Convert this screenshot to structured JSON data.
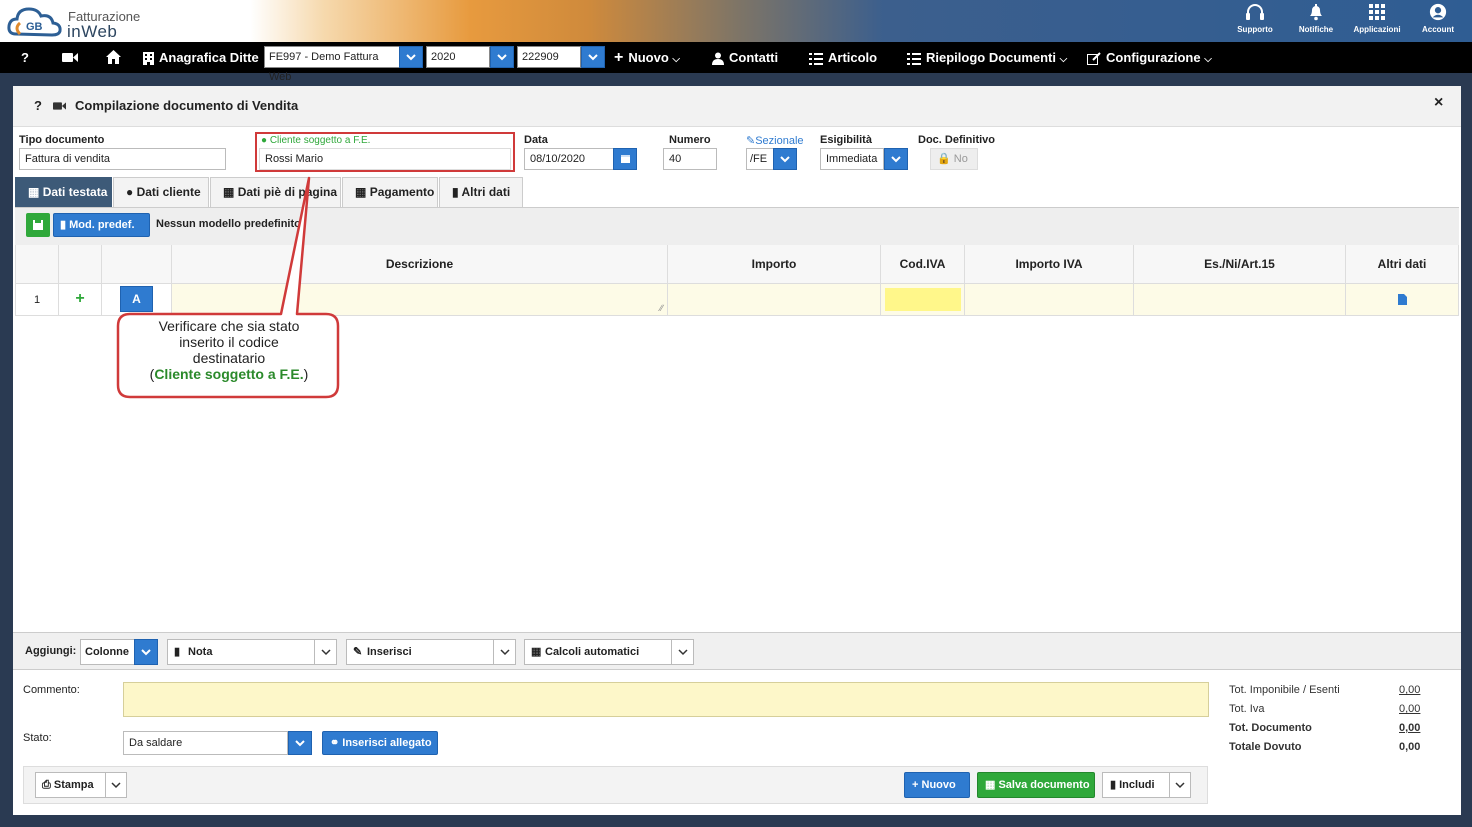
{
  "brand": {
    "line1": "Fatturazione",
    "line2": "inWeb"
  },
  "top_icons": [
    {
      "label": "Supporto",
      "icon": "headset-icon"
    },
    {
      "label": "Notifiche",
      "icon": "bell-icon"
    },
    {
      "label": "Applicazioni",
      "icon": "apps-grid-icon"
    },
    {
      "label": "Account",
      "icon": "account-icon"
    }
  ],
  "nav": {
    "help": "?",
    "anagrafica": "Anagrafica Ditte",
    "company": "FE997 - Demo Fattura Web",
    "year": "2020",
    "code": "222909",
    "nuovo": "Nuovo",
    "contatti": "Contatti",
    "articolo": "Articolo",
    "riepilogo": "Riepilogo Documenti",
    "configurazione": "Configurazione"
  },
  "window": {
    "help": "?",
    "title": "Compilazione documento di Vendita",
    "close": "×"
  },
  "form": {
    "tipo_label": "Tipo documento",
    "tipo_value": "Fattura di vendita",
    "cliente_label": "Cliente soggetto a F.E.",
    "cliente_value": "Rossi Mario",
    "data_label": "Data",
    "data_value": "08/10/2020",
    "numero_label": "Numero",
    "numero_value": "40",
    "sezionale_label": "Sezionale",
    "sezionale_value": "/FE",
    "esig_label": "Esigibilità",
    "esig_value": "Immediata",
    "def_label": "Doc. Definitivo",
    "def_value": "No"
  },
  "tabs": [
    "Dati testata",
    "Dati cliente",
    "Dati piè di pagina",
    "Pagamento",
    "Altri dati"
  ],
  "model": {
    "btn": "Mod. predef.",
    "text": "Nessun modello predefinito"
  },
  "grid": {
    "headers": [
      "Descrizione",
      "Importo",
      "Cod.IVA",
      "Importo IVA",
      "Es./Ni/Art.15",
      "Altri dati"
    ],
    "row_num": "1",
    "row_add": "+",
    "row_a": "A"
  },
  "callout": {
    "line1": "Verificare che sia stato",
    "line2": "inserito il codice",
    "line3": "destinatario",
    "open": "(",
    "highlight": "Cliente soggetto a F.E.",
    "close": ")"
  },
  "footer": {
    "aggiungi": "Aggiungi:",
    "colonne": "Colonne",
    "nota": "Nota",
    "inserisci": "Inserisci",
    "calcoli": "Calcoli automatici",
    "commento": "Commento:",
    "stato": "Stato:",
    "stato_value": "Da saldare",
    "allegato": "Inserisci allegato",
    "stampa": "Stampa",
    "nuovo": "Nuovo",
    "salva": "Salva documento",
    "includi": "Includi"
  },
  "totals": [
    {
      "label": "Tot. Imponibile / Esenti",
      "value": "0,00"
    },
    {
      "label": "Tot. Iva",
      "value": "0,00"
    },
    {
      "label": "Tot. Documento",
      "value": "0,00"
    },
    {
      "label": "Totale Dovuto",
      "value": "0,00"
    }
  ],
  "colors": {
    "accent": "#2f7bd0",
    "green": "#2fa83a",
    "highlight": "#d03a3a"
  }
}
